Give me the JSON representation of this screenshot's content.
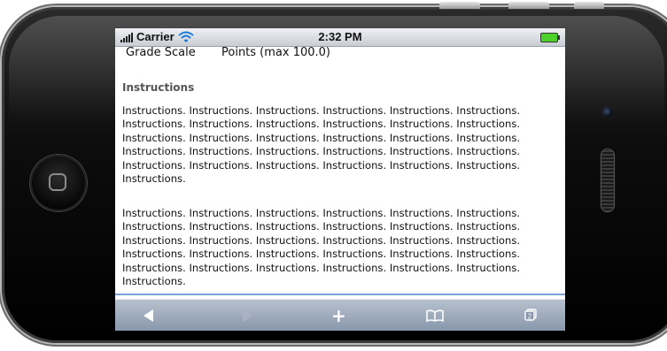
{
  "status": {
    "carrier": "Carrier",
    "time": "2:32 PM"
  },
  "grade": {
    "label": "Grade Scale",
    "value": "Points (max 100.0)"
  },
  "instructions": {
    "heading": "Instructions",
    "paragraphs": [
      "Instructions. Instructions. Instructions. Instructions. Instructions. Instructions. Instructions. Instructions. Instructions. Instructions. Instructions. Instructions. Instructions. Instructions. Instructions. Instructions. Instructions. Instructions. Instructions. Instructions. Instructions. Instructions. Instructions. Instructions. Instructions. Instructions. Instructions. Instructions. Instructions. Instructions. Instructions.",
      "Instructions. Instructions. Instructions. Instructions. Instructions. Instructions. Instructions. Instructions. Instructions. Instructions. Instructions. Instructions. Instructions. Instructions. Instructions. Instructions. Instructions. Instructions. Instructions. Instructions. Instructions. Instructions. Instructions. Instructions. Instructions. Instructions. Instructions. Instructions. Instructions. Instructions. Instructions."
    ]
  },
  "toolbar": {
    "pages_count": "2"
  },
  "icons": {
    "signal": "signal-bars-icon",
    "wifi": "wifi-icon",
    "battery": "battery-icon",
    "back": "back-arrow-icon",
    "forward": "forward-arrow-icon",
    "add": "plus-icon",
    "bookmarks": "book-icon",
    "pages": "pages-icon",
    "home": "home-button-icon"
  },
  "colors": {
    "battery": "#4cd12b",
    "link_border": "#79a2d6"
  }
}
